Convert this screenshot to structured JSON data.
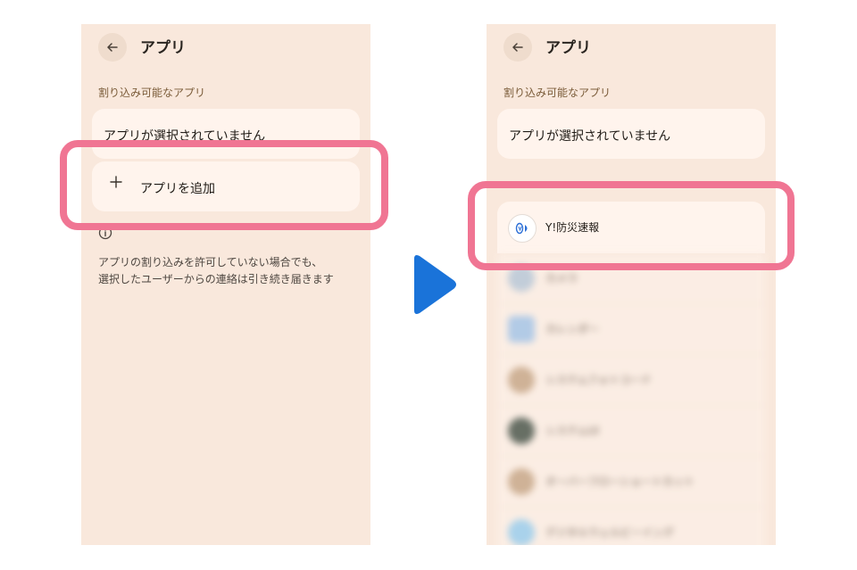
{
  "left_screen": {
    "title": "アプリ",
    "section_label": "割り込み可能なアプリ",
    "no_apps_text": "アプリが選択されていません",
    "add_app_label": "アプリを追加",
    "info_line1": "アプリの割り込みを許可していない場合でも、",
    "info_line2": "選択したユーザーからの連絡は引き続き届きます"
  },
  "right_screen": {
    "title": "アプリ",
    "section_label": "割り込み可能なアプリ",
    "no_apps_text": "アプリが選択されていません",
    "first_app_name": "Y!防災速報",
    "blurred_apps": [
      "カメラ",
      "カレンダー",
      "システムフォトコード",
      "システムUI",
      "オーバーフローショートカット",
      "デジタルウェルビーイング"
    ]
  },
  "colors": {
    "screen_background": "#f9e8dc",
    "card_background": "#fff4ed",
    "highlight": "#f07593",
    "arrow": "#1a73d9",
    "section_label": "#7a5b38"
  },
  "icons": {
    "back": "arrow-left-icon",
    "add": "plus-icon",
    "info": "info-circle-icon",
    "transition": "play-arrow-icon"
  }
}
